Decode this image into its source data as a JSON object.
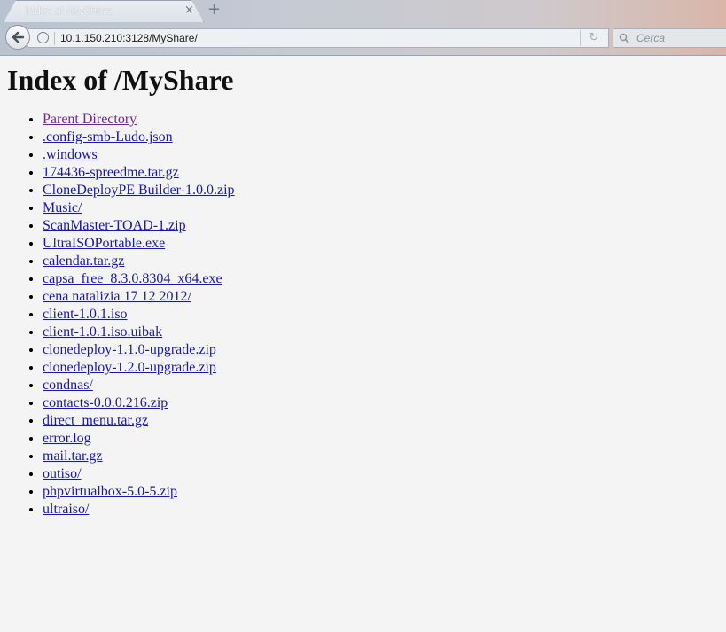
{
  "browser": {
    "tab": {
      "title": "Index of /MyShare",
      "close_glyph": "×"
    },
    "new_tab_glyph": "+",
    "address": {
      "url": "10.1.150.210:3128/MyShare/"
    },
    "search": {
      "placeholder": "Cerca"
    },
    "icons": [
      "back-arrow-icon",
      "info-icon",
      "reload-icon",
      "search-icon",
      "close-icon",
      "plus-icon"
    ]
  },
  "page": {
    "title": "Index of /MyShare",
    "entries": [
      {
        "label": "Parent Directory",
        "visited": true
      },
      {
        "label": ".config-smb-Ludo.json"
      },
      {
        "label": ".windows"
      },
      {
        "label": "174436-spreedme.tar.gz"
      },
      {
        "label": "CloneDeployPE Builder-1.0.0.zip"
      },
      {
        "label": "Music/"
      },
      {
        "label": "ScanMaster-TOAD-1.zip"
      },
      {
        "label": "UltraISOPortable.exe"
      },
      {
        "label": "calendar.tar.gz"
      },
      {
        "label": "capsa_free_8.3.0.8304_x64.exe"
      },
      {
        "label": "cena natalizia 17 12 2012/"
      },
      {
        "label": "client-1.0.1.iso"
      },
      {
        "label": "client-1.0.1.iso.uibak"
      },
      {
        "label": "clonedeploy-1.1.0-upgrade.zip"
      },
      {
        "label": "clonedeploy-1.2.0-upgrade.zip"
      },
      {
        "label": "condnas/"
      },
      {
        "label": "contacts-0.0.0.216.zip"
      },
      {
        "label": "direct_menu.tar.gz"
      },
      {
        "label": "error.log"
      },
      {
        "label": "mail.tar.gz"
      },
      {
        "label": "outiso/"
      },
      {
        "label": "phpvirtualbox-5.0-5.zip"
      },
      {
        "label": "ultraiso/"
      }
    ]
  },
  "colors": {
    "link": "#1a1aa6",
    "visited_link": "#6b2a8a",
    "page_bg": "#f4f4f4"
  }
}
